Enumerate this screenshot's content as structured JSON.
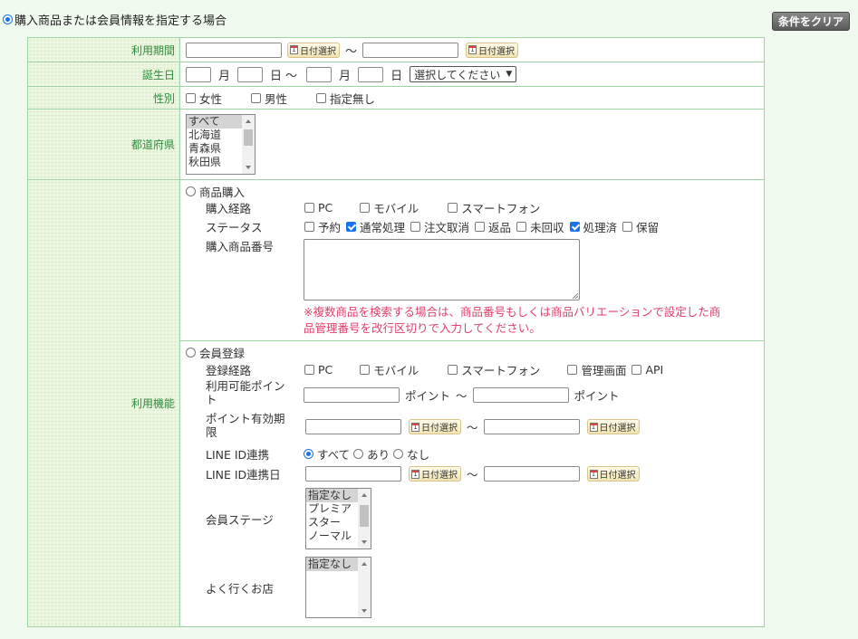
{
  "header": {
    "mode_label": "購入商品または会員情報を指定する場合",
    "clear_button": "条件をクリア"
  },
  "calendar_button": "日付選択",
  "labels": {
    "usage_period": "利用期間",
    "birthday": "誕生日",
    "gender": "性別",
    "prefecture": "都道府県",
    "feature": "利用機能"
  },
  "usage_period": {
    "from": "",
    "to": "",
    "separator": "～"
  },
  "birthday": {
    "month_unit": "月",
    "day_unit": "日",
    "range_sep": "～",
    "select_value": "選択してください"
  },
  "gender": {
    "options": [
      "女性",
      "男性",
      "指定無し"
    ]
  },
  "prefecture": {
    "options": [
      "すべて",
      "北海道",
      "青森県",
      "秋田県"
    ]
  },
  "purchase": {
    "title": "商品購入",
    "channel_label": "購入経路",
    "channels": [
      "PC",
      "モバイル",
      "スマートフォン"
    ],
    "status_label": "ステータス",
    "statuses": [
      {
        "label": "予約",
        "checked": false
      },
      {
        "label": "通常処理",
        "checked": true
      },
      {
        "label": "注文取消",
        "checked": false
      },
      {
        "label": "返品",
        "checked": false
      },
      {
        "label": "未回収",
        "checked": false
      },
      {
        "label": "処理済",
        "checked": true
      },
      {
        "label": "保留",
        "checked": false
      }
    ],
    "product_no_label": "購入商品番号",
    "note_line1": "※複数商品を検索する場合は、商品番号もしくは商品バリエーションで設定した商",
    "note_line2": "品管理番号を改行区切りで入力してください。"
  },
  "member": {
    "title": "会員登録",
    "reg_channel_label": "登録経路",
    "reg_channels": [
      "PC",
      "モバイル",
      "スマートフォン",
      "管理画面",
      "API"
    ],
    "points_label_1": "利用可能ポイン",
    "points_label_2": "ト",
    "point_unit": "ポイント",
    "range_sep": "～",
    "point_expiry_label_1": "ポイント有効期",
    "point_expiry_label_2": "限",
    "line_label": "LINE ID連携",
    "line_options": [
      {
        "label": "すべて",
        "selected": true
      },
      {
        "label": "あり",
        "selected": false
      },
      {
        "label": "なし",
        "selected": false
      }
    ],
    "line_date_label": "LINE ID連携日",
    "stage_label": "会員ステージ",
    "stages": [
      "指定なし",
      "プレミア",
      "スター",
      "ノーマル"
    ],
    "shop_label": "よく行くお店",
    "shops": [
      "指定なし"
    ]
  }
}
